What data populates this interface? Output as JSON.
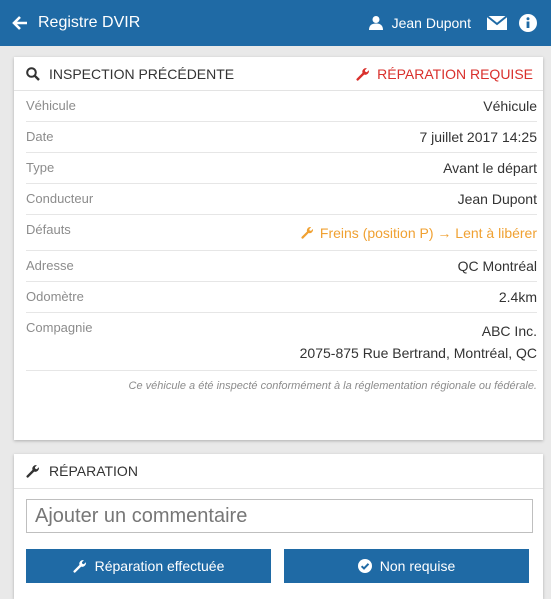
{
  "header": {
    "title": "Registre DVIR",
    "user_name": "Jean Dupont",
    "icons": [
      "back-arrow-icon",
      "user-icon",
      "envelope-icon",
      "info-icon"
    ]
  },
  "inspection": {
    "heading": "INSPECTION PRÉCÉDENTE",
    "status": "RÉPARATION REQUISE",
    "status_color": "#d9302c",
    "rows": {
      "vehicle": {
        "label": "Véhicule",
        "value": "Véhicule"
      },
      "date": {
        "label": "Date",
        "value": "7 juillet 2017 14:25"
      },
      "type": {
        "label": "Type",
        "value": "Avant le départ"
      },
      "driver": {
        "label": "Conducteur",
        "value": "Jean Dupont"
      },
      "defects": {
        "label": "Défauts",
        "value": "Freins (position P) → Lent à libérer"
      },
      "address": {
        "label": "Adresse",
        "value": "QC Montréal"
      },
      "odometer": {
        "label": "Odomètre",
        "value": "2.4km"
      },
      "company": {
        "label": "Compagnie",
        "value_name": "ABC Inc.",
        "value_address": "2075-875 Rue Bertrand, Montréal, QC"
      }
    },
    "note": "Ce véhicule a été inspecté conformément à la réglementation régionale ou fédérale."
  },
  "repair": {
    "heading": "RÉPARATION",
    "comment_placeholder": "Ajouter un commentaire",
    "done_button": "Réparation effectuée",
    "not_required_button": "Non requise"
  },
  "colors": {
    "primary": "#1f6aa5",
    "warning": "#f0a132",
    "danger": "#d9302c"
  }
}
